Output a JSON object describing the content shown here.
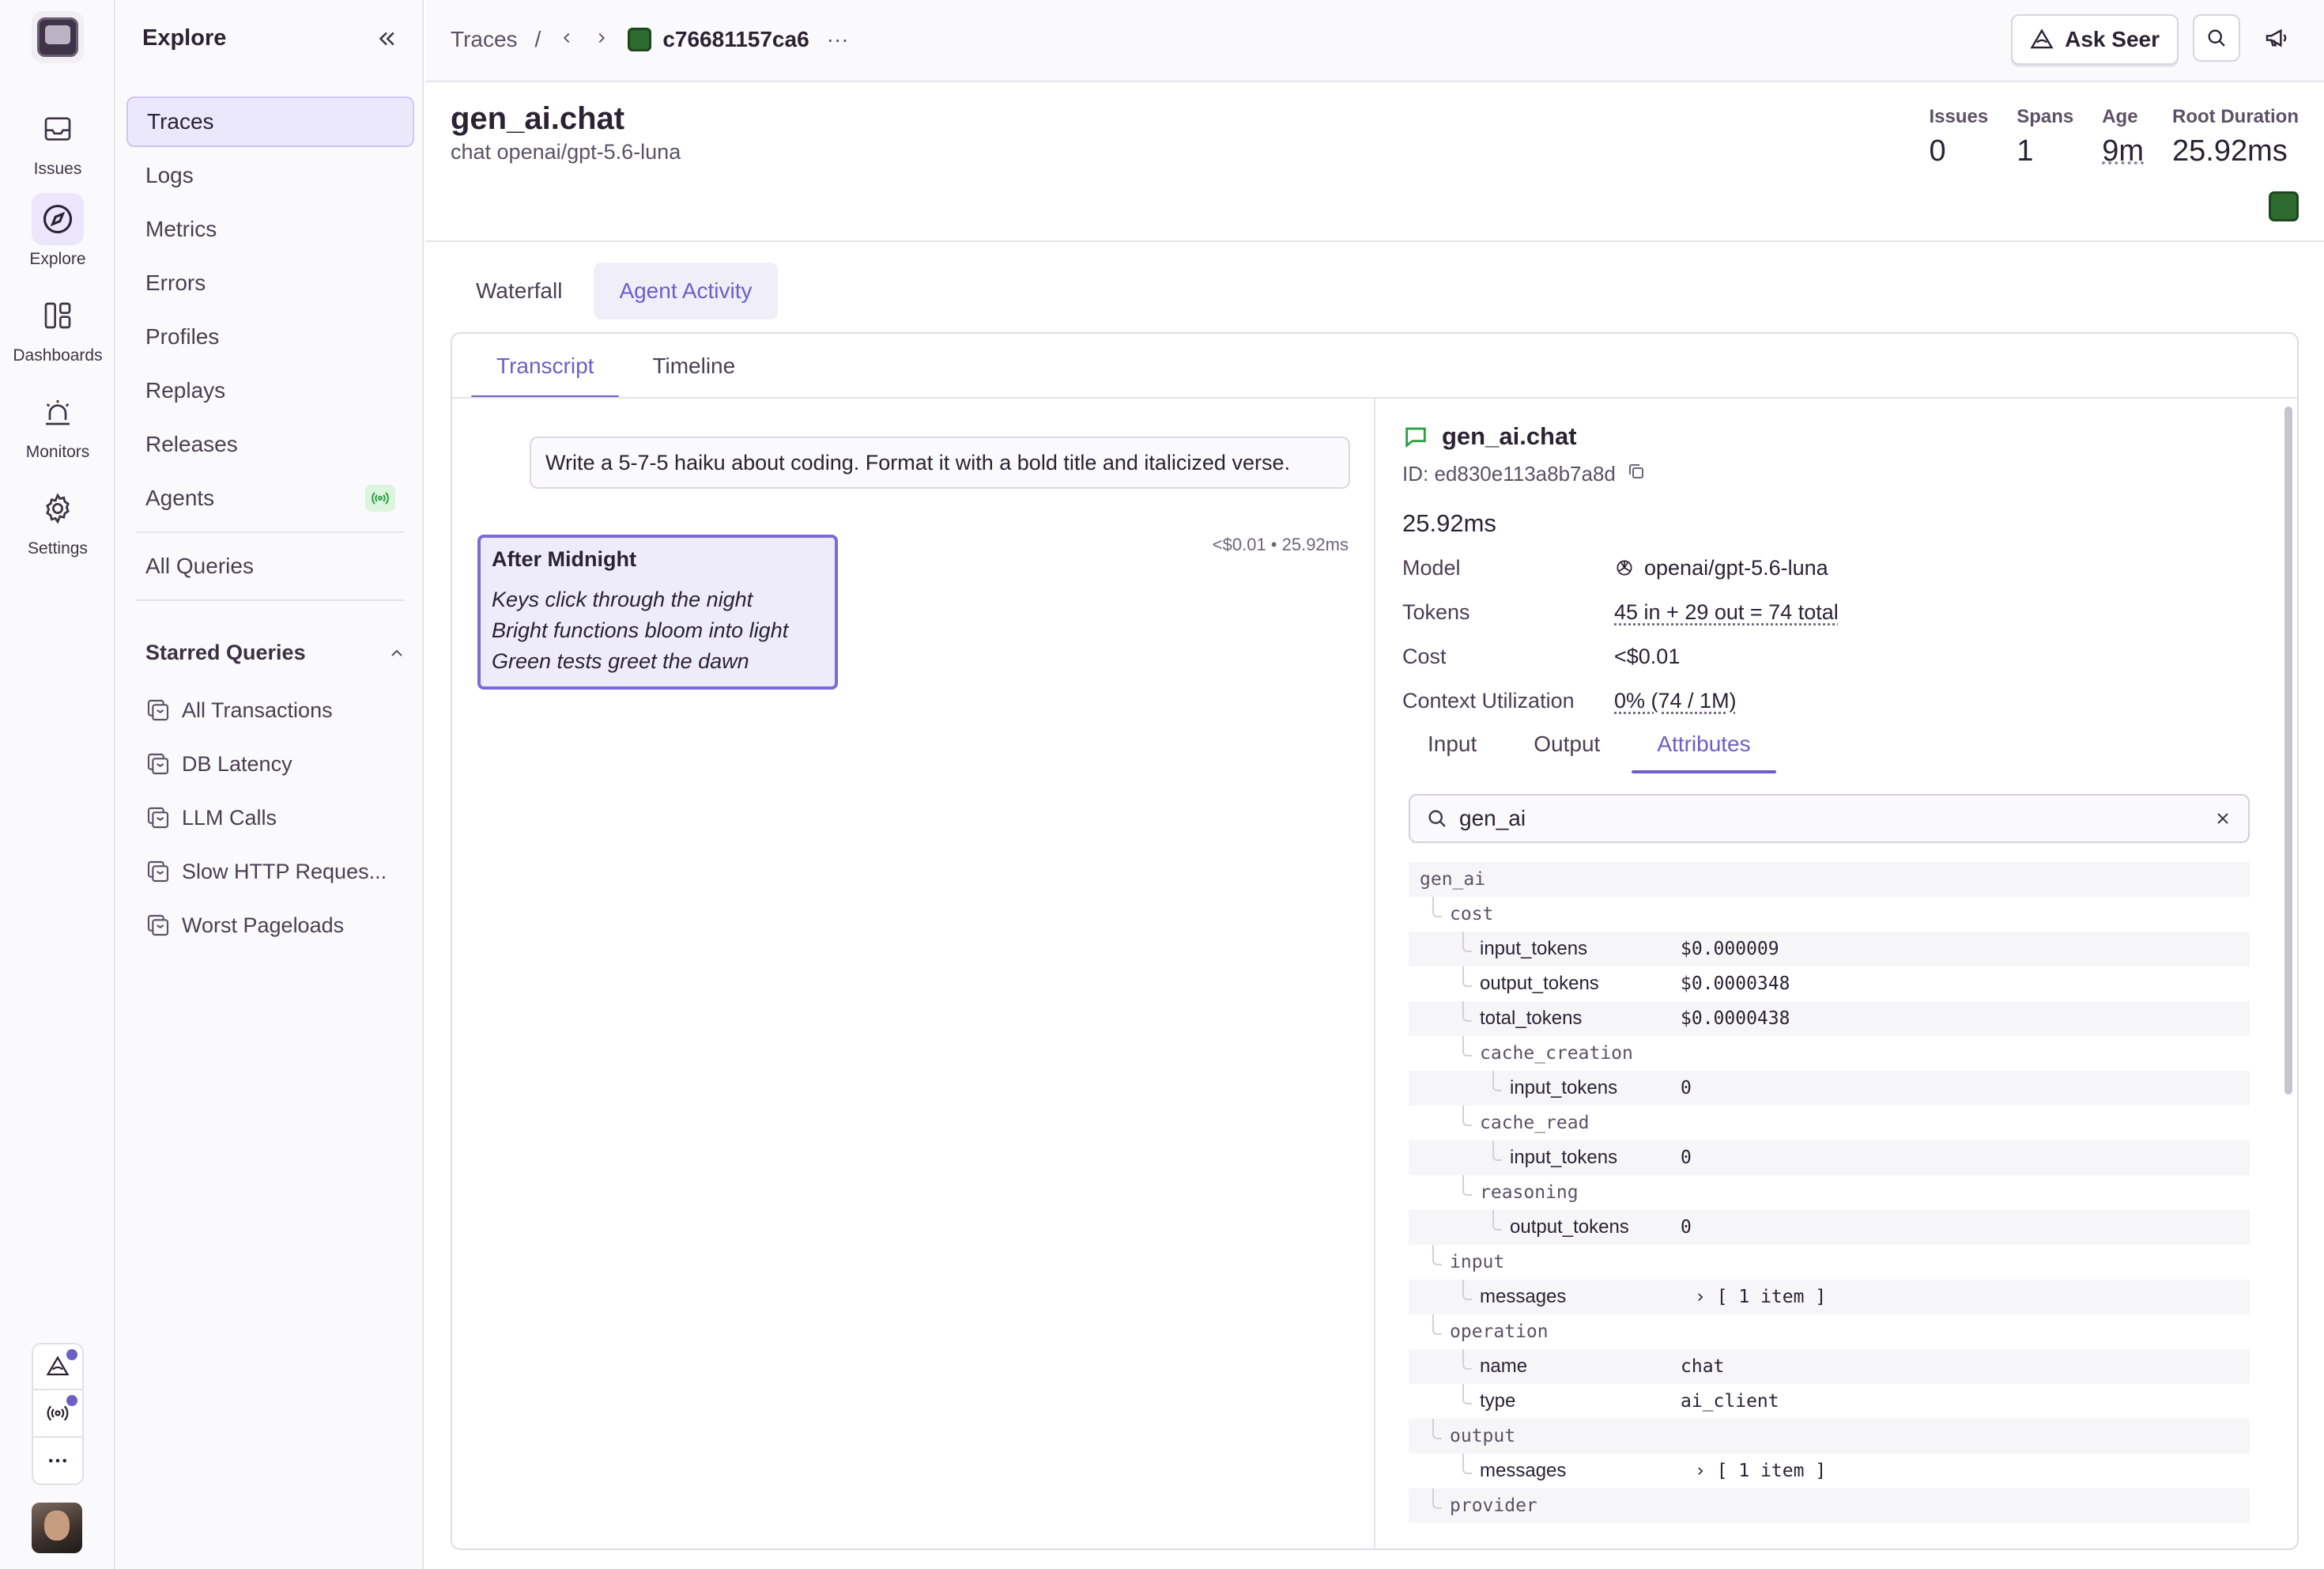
{
  "rail": {
    "items": [
      {
        "label": "Issues",
        "icon": "inbox-icon"
      },
      {
        "label": "Explore",
        "icon": "compass-icon"
      },
      {
        "label": "Dashboards",
        "icon": "dashboard-icon"
      },
      {
        "label": "Monitors",
        "icon": "siren-icon"
      },
      {
        "label": "Settings",
        "icon": "gear-icon"
      }
    ]
  },
  "sidebar": {
    "title": "Explore",
    "nav": [
      {
        "label": "Traces"
      },
      {
        "label": "Logs"
      },
      {
        "label": "Metrics"
      },
      {
        "label": "Errors"
      },
      {
        "label": "Profiles"
      },
      {
        "label": "Replays"
      },
      {
        "label": "Releases"
      },
      {
        "label": "Agents"
      }
    ],
    "all_queries": "All Queries",
    "starred_title": "Starred Queries",
    "starred": [
      {
        "label": "All Transactions"
      },
      {
        "label": "DB Latency"
      },
      {
        "label": "LLM Calls"
      },
      {
        "label": "Slow HTTP Reques..."
      },
      {
        "label": "Worst Pageloads"
      }
    ]
  },
  "topbar": {
    "crumb_traces": "Traces",
    "crumb_sep": "/",
    "trace_id": "c76681157ca6",
    "more": "···",
    "ask_seer": "Ask Seer"
  },
  "header": {
    "title": "gen_ai.chat",
    "subtitle": "chat openai/gpt-5.6-luna",
    "stats": [
      {
        "key": "Issues",
        "value": "0"
      },
      {
        "key": "Spans",
        "value": "1"
      },
      {
        "key": "Age",
        "value": "9m"
      },
      {
        "key": "Root Duration",
        "value": "25.92ms"
      }
    ]
  },
  "view_tabs": [
    "Waterfall",
    "Agent Activity"
  ],
  "sub_tabs": [
    "Transcript",
    "Timeline"
  ],
  "transcript": {
    "user_message": "Write a 5-7-5 haiku about coding. Format it with a bold title and italicized verse.",
    "meta": "<$0.01 • 25.92ms",
    "assistant_title": "After Midnight",
    "assistant_lines": [
      "Keys click through the night",
      "Bright functions bloom into light",
      "Green tests greet the dawn"
    ]
  },
  "details": {
    "title": "gen_ai.chat",
    "id": "ID: ed830e113a8b7a8d",
    "duration": "25.92ms",
    "rows": [
      {
        "key": "Model",
        "value": "openai/gpt-5.6-luna"
      },
      {
        "key": "Tokens",
        "value": "45 in + 29 out = 74 total"
      },
      {
        "key": "Cost",
        "value": "<$0.01"
      },
      {
        "key": "Context Utilization",
        "value": "0% (74 / 1M)"
      }
    ],
    "tabs": [
      "Input",
      "Output",
      "Attributes"
    ],
    "search_value": "gen_ai",
    "tree": [
      {
        "name": "gen_ai",
        "value": "",
        "depth": 0,
        "group": true
      },
      {
        "name": "cost",
        "value": "",
        "depth": 1,
        "group": true
      },
      {
        "name": "input_tokens",
        "value": "$0.000009",
        "depth": 2,
        "group": false
      },
      {
        "name": "output_tokens",
        "value": "$0.0000348",
        "depth": 2,
        "group": false
      },
      {
        "name": "total_tokens",
        "value": "$0.0000438",
        "depth": 2,
        "group": false
      },
      {
        "name": "cache_creation",
        "value": "",
        "depth": 2,
        "group": true
      },
      {
        "name": "input_tokens",
        "value": "0",
        "depth": 3,
        "group": false
      },
      {
        "name": "cache_read",
        "value": "",
        "depth": 2,
        "group": true
      },
      {
        "name": "input_tokens",
        "value": "0",
        "depth": 3,
        "group": false
      },
      {
        "name": "reasoning",
        "value": "",
        "depth": 2,
        "group": true
      },
      {
        "name": "output_tokens",
        "value": "0",
        "depth": 3,
        "group": false
      },
      {
        "name": "input",
        "value": "",
        "depth": 1,
        "group": true
      },
      {
        "name": "messages",
        "value": "› [ 1 item ]",
        "depth": 2,
        "group": false
      },
      {
        "name": "operation",
        "value": "",
        "depth": 1,
        "group": true
      },
      {
        "name": "name",
        "value": "chat",
        "depth": 2,
        "group": false
      },
      {
        "name": "type",
        "value": "ai_client",
        "depth": 2,
        "group": false
      },
      {
        "name": "output",
        "value": "",
        "depth": 1,
        "group": true
      },
      {
        "name": "messages",
        "value": "› [ 1 item ]",
        "depth": 2,
        "group": false
      },
      {
        "name": "provider",
        "value": "",
        "depth": 1,
        "group": true
      }
    ]
  },
  "colors": {
    "accent": "#6c5fc7",
    "project": "#2d6a2e",
    "live": "#2ba144"
  }
}
